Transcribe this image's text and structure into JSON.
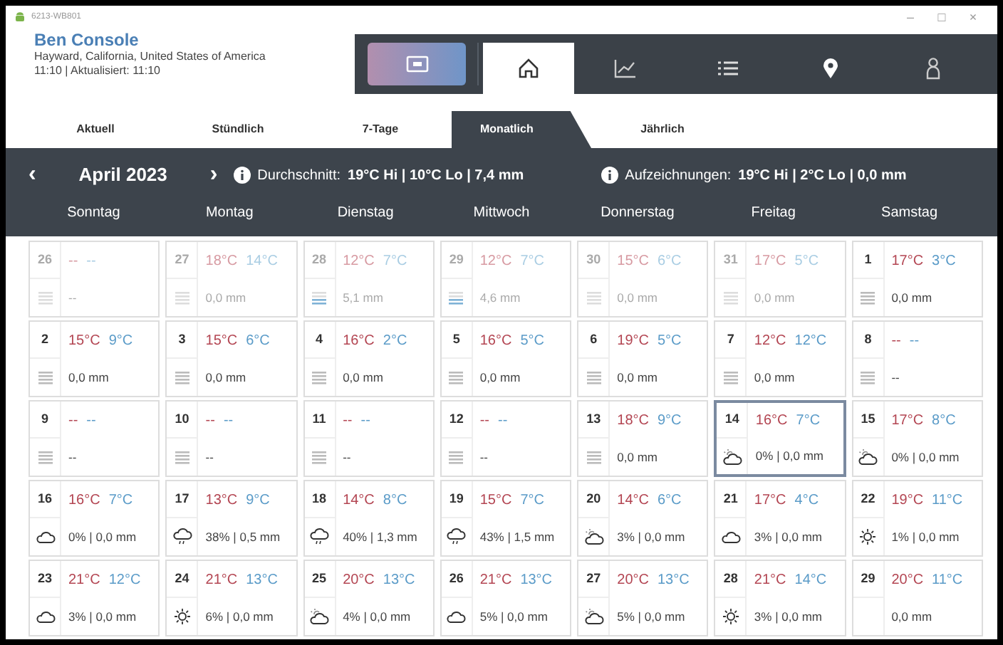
{
  "window": {
    "title": "6213-WB801",
    "controls": [
      "–",
      "□",
      "×"
    ]
  },
  "header": {
    "name": "Ben Console",
    "location": "Hayward, California, United States of America",
    "updated": "11:10 | Aktualisiert: 11:10"
  },
  "nav_icons": [
    {
      "kind": "home",
      "selected": true
    },
    {
      "kind": "chart",
      "selected": false
    },
    {
      "kind": "list",
      "selected": false
    },
    {
      "kind": "pin",
      "selected": false
    },
    {
      "kind": "person",
      "selected": false
    }
  ],
  "tabs": [
    {
      "label": "Aktuell",
      "selected": false
    },
    {
      "label": "Stündlich",
      "selected": false
    },
    {
      "label": "7-Tage",
      "selected": false
    },
    {
      "label": "Monatlich",
      "selected": true
    },
    {
      "label": "Jährlich",
      "selected": false
    }
  ],
  "month_bar": {
    "prev": "‹",
    "month": "April 2023",
    "next": "›",
    "average_label": "Durchschnitt:",
    "average": "19°C Hi | 10°C Lo | 7,4 mm",
    "records_label": "Aufzeichnungen:",
    "records": "19°C Hi | 2°C Lo | 0,0 mm"
  },
  "weekdays": [
    "Sonntag",
    "Montag",
    "Dienstag",
    "Mittwoch",
    "Donnerstag",
    "Freitag",
    "Samstag"
  ],
  "days": [
    {
      "day": "26",
      "hi": "--",
      "lo": "--",
      "kind": "gauge",
      "precip": "--",
      "dimmed": true,
      "selected": false
    },
    {
      "day": "27",
      "hi": "18°C",
      "lo": "14°C",
      "kind": "gauge",
      "precip": "0,0 mm",
      "dimmed": true,
      "selected": false
    },
    {
      "day": "28",
      "hi": "12°C",
      "lo": "7°C",
      "kind": "wetgauge",
      "precip": "5,1 mm",
      "dimmed": true,
      "selected": false
    },
    {
      "day": "29",
      "hi": "12°C",
      "lo": "7°C",
      "kind": "wetgauge",
      "precip": "4,6 mm",
      "dimmed": true,
      "selected": false
    },
    {
      "day": "30",
      "hi": "15°C",
      "lo": "6°C",
      "kind": "gauge",
      "precip": "0,0 mm",
      "dimmed": true,
      "selected": false
    },
    {
      "day": "31",
      "hi": "17°C",
      "lo": "5°C",
      "kind": "gauge",
      "precip": "0,0 mm",
      "dimmed": true,
      "selected": false
    },
    {
      "day": "1",
      "hi": "17°C",
      "lo": "3°C",
      "kind": "gauge",
      "precip": "0,0 mm",
      "dimmed": false,
      "selected": false
    },
    {
      "day": "2",
      "hi": "15°C",
      "lo": "9°C",
      "kind": "gauge",
      "precip": "0,0 mm",
      "dimmed": false,
      "selected": false
    },
    {
      "day": "3",
      "hi": "15°C",
      "lo": "6°C",
      "kind": "gauge",
      "precip": "0,0 mm",
      "dimmed": false,
      "selected": false
    },
    {
      "day": "4",
      "hi": "16°C",
      "lo": "2°C",
      "kind": "gauge",
      "precip": "0,0 mm",
      "dimmed": false,
      "selected": false
    },
    {
      "day": "5",
      "hi": "16°C",
      "lo": "5°C",
      "kind": "gauge",
      "precip": "0,0 mm",
      "dimmed": false,
      "selected": false
    },
    {
      "day": "6",
      "hi": "19°C",
      "lo": "5°C",
      "kind": "gauge",
      "precip": "0,0 mm",
      "dimmed": false,
      "selected": false
    },
    {
      "day": "7",
      "hi": "12°C",
      "lo": "12°C",
      "kind": "gauge",
      "precip": "0,0 mm",
      "dimmed": false,
      "selected": false
    },
    {
      "day": "8",
      "hi": "--",
      "lo": "--",
      "kind": "gauge",
      "precip": "--",
      "dimmed": false,
      "selected": false
    },
    {
      "day": "9",
      "hi": "--",
      "lo": "--",
      "kind": "gauge",
      "precip": "--",
      "dimmed": false,
      "selected": false
    },
    {
      "day": "10",
      "hi": "--",
      "lo": "--",
      "kind": "gauge",
      "precip": "--",
      "dimmed": false,
      "selected": false
    },
    {
      "day": "11",
      "hi": "--",
      "lo": "--",
      "kind": "gauge",
      "precip": "--",
      "dimmed": false,
      "selected": false
    },
    {
      "day": "12",
      "hi": "--",
      "lo": "--",
      "kind": "gauge",
      "precip": "--",
      "dimmed": false,
      "selected": false
    },
    {
      "day": "13",
      "hi": "18°C",
      "lo": "9°C",
      "kind": "gauge",
      "precip": "0,0 mm",
      "dimmed": false,
      "selected": false
    },
    {
      "day": "14",
      "hi": "16°C",
      "lo": "7°C",
      "kind": "partly",
      "precip": "0% | 0,0 mm",
      "dimmed": false,
      "selected": true
    },
    {
      "day": "15",
      "hi": "17°C",
      "lo": "8°C",
      "kind": "partly",
      "precip": "0% | 0,0 mm",
      "dimmed": false,
      "selected": false
    },
    {
      "day": "16",
      "hi": "16°C",
      "lo": "7°C",
      "kind": "cloud",
      "precip": "0% | 0,0 mm",
      "dimmed": false,
      "selected": false
    },
    {
      "day": "17",
      "hi": "13°C",
      "lo": "9°C",
      "kind": "rain",
      "precip": "38% | 0,5 mm",
      "dimmed": false,
      "selected": false
    },
    {
      "day": "18",
      "hi": "14°C",
      "lo": "8°C",
      "kind": "rain",
      "precip": "40% | 1,3 mm",
      "dimmed": false,
      "selected": false
    },
    {
      "day": "19",
      "hi": "15°C",
      "lo": "7°C",
      "kind": "rain",
      "precip": "43% | 1,5 mm",
      "dimmed": false,
      "selected": false
    },
    {
      "day": "20",
      "hi": "14°C",
      "lo": "6°C",
      "kind": "partly",
      "precip": "3% | 0,0 mm",
      "dimmed": false,
      "selected": false
    },
    {
      "day": "21",
      "hi": "17°C",
      "lo": "4°C",
      "kind": "cloud",
      "precip": "3% | 0,0 mm",
      "dimmed": false,
      "selected": false
    },
    {
      "day": "22",
      "hi": "19°C",
      "lo": "11°C",
      "kind": "sun",
      "precip": "1% | 0,0 mm",
      "dimmed": false,
      "selected": false
    },
    {
      "day": "23",
      "hi": "21°C",
      "lo": "12°C",
      "kind": "cloud",
      "precip": "3% | 0,0 mm",
      "dimmed": false,
      "selected": false
    },
    {
      "day": "24",
      "hi": "21°C",
      "lo": "13°C",
      "kind": "sun",
      "precip": "6% | 0,0 mm",
      "dimmed": false,
      "selected": false
    },
    {
      "day": "25",
      "hi": "20°C",
      "lo": "13°C",
      "kind": "partly",
      "precip": "4% | 0,0 mm",
      "dimmed": false,
      "selected": false
    },
    {
      "day": "26",
      "hi": "21°C",
      "lo": "13°C",
      "kind": "cloud",
      "precip": "5% | 0,0 mm",
      "dimmed": false,
      "selected": false
    },
    {
      "day": "27",
      "hi": "20°C",
      "lo": "13°C",
      "kind": "partly",
      "precip": "5% | 0,0 mm",
      "dimmed": false,
      "selected": false
    },
    {
      "day": "28",
      "hi": "21°C",
      "lo": "14°C",
      "kind": "sun",
      "precip": "3% | 0,0 mm",
      "dimmed": false,
      "selected": false
    },
    {
      "day": "29",
      "hi": "20°C",
      "lo": "11°C",
      "kind": "none",
      "precip": "0,0 mm",
      "dimmed": false,
      "selected": false
    }
  ]
}
